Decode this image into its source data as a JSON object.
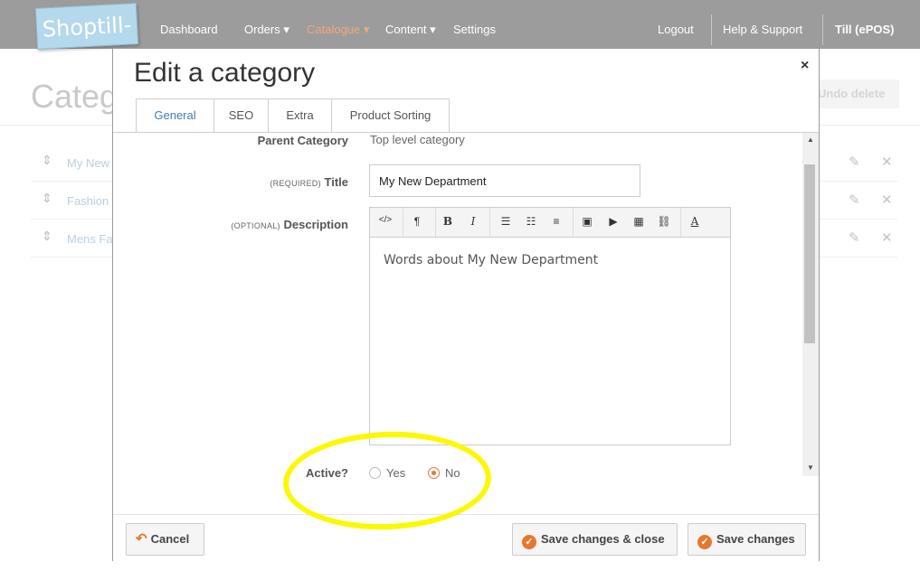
{
  "app": {
    "logo_text": "Shoptill-e"
  },
  "nav": {
    "dashboard": "Dashboard",
    "orders": "Orders ▾",
    "catalogue": "Catalogue ▾",
    "content": "Content ▾",
    "settings": "Settings",
    "logout": "Logout",
    "help": "Help & Support",
    "till": "Till (ePOS)"
  },
  "background": {
    "page_title": "Categ",
    "undo_label": "Undo delete",
    "rows": [
      {
        "label": "My New"
      },
      {
        "label": "Fashion"
      },
      {
        "label": "Mens Fa"
      }
    ]
  },
  "modal": {
    "title": "Edit a category",
    "close": "×",
    "tabs": [
      "General",
      "SEO",
      "Extra",
      "Product Sorting"
    ],
    "parent_category_label": "Parent Category",
    "parent_category_value": "Top level category",
    "title_req": "(REQUIRED)",
    "title_label": "Title",
    "title_value": "My New Department",
    "desc_opt": "(OPTIONAL)",
    "desc_label": "Description",
    "desc_value": "Words about My New Department",
    "active_label": "Active?",
    "active_yes": "Yes",
    "active_no": "No",
    "active_selected": "No",
    "cancel": "Cancel",
    "save_close": "Save changes & close",
    "save": "Save changes"
  },
  "colors": {
    "accent": "#e8772e",
    "highlight": "#fbf800",
    "link": "#3c7fb6"
  }
}
